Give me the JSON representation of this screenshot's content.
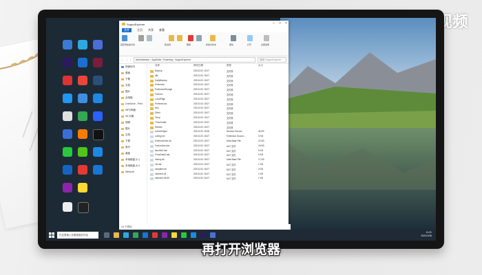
{
  "watermark": "天奇·视频",
  "subtitle": "再打开浏览器",
  "explorer": {
    "title": "SogouExplorer",
    "tabs": [
      "文件",
      "主页",
      "共享",
      "查看"
    ],
    "active_tab": "主页",
    "ribbon": [
      "固定到快速访问",
      "复制",
      "粘贴",
      "移动到",
      "复制到",
      "删除",
      "重命名",
      "新建文件夹",
      "属性",
      "打开",
      "全部选择"
    ],
    "address": [
      "Administrator",
      "AppData",
      "Roaming",
      "SogouExplorer"
    ],
    "search_placeholder": "搜索\"SogouExplorer\"",
    "columns": [
      "名称",
      "修改日期",
      "类型",
      "大小"
    ],
    "files": [
      {
        "name": "Backup",
        "date": "2021/1/21 15:07",
        "type": "文件夹",
        "size": ""
      },
      {
        "name": "dlls",
        "date": "2021/1/21 15:07",
        "type": "文件夹",
        "size": ""
      },
      {
        "name": "DailyBackup",
        "date": "2021/1/21 15:07",
        "type": "文件夹",
        "size": ""
      },
      {
        "name": "Extension",
        "date": "2021/1/21 15:07",
        "type": "文件夹",
        "size": ""
      },
      {
        "name": "ExtensionStorage",
        "date": "2021/1/21 15:07",
        "type": "文件夹",
        "size": ""
      },
      {
        "name": "FavIcon",
        "date": "2021/1/21 15:07",
        "type": "文件夹",
        "size": ""
      },
      {
        "name": "LocalPage",
        "date": "2021/1/21 15:07",
        "type": "文件夹",
        "size": ""
      },
      {
        "name": "Preferences",
        "date": "2021/1/21 15:07",
        "type": "文件夹",
        "size": ""
      },
      {
        "name": "skin",
        "date": "2021/1/21 15:07",
        "type": "文件夹",
        "size": ""
      },
      {
        "name": "Skins",
        "date": "2021/1/21 15:07",
        "type": "文件夹",
        "size": ""
      },
      {
        "name": "Temp",
        "date": "2021/1/21 15:07",
        "type": "文件夹",
        "size": ""
      },
      {
        "name": "Thumbnails",
        "date": "2021/1/21 15:07",
        "type": "文件夹",
        "size": ""
      },
      {
        "name": "WebAd",
        "date": "2021/1/21 15:07",
        "type": "文件夹",
        "size": ""
      },
      {
        "name": "cometoSgurl",
        "date": "2021/1/21 15:08",
        "type": "Neutron Docum...",
        "size": "46 KB"
      },
      {
        "name": "config.xml",
        "date": "2021/1/21 15:07",
        "type": "Extension Docum...",
        "size": "3 KB"
      },
      {
        "name": "ExtensionInfo.db",
        "date": "2021/1/21 15:07",
        "type": "Data Base File",
        "size": "22 KB"
      },
      {
        "name": "FavIconIdx.dat",
        "date": "2021/1/21 15:07",
        "type": "DAT 文件",
        "size": "16 KB"
      },
      {
        "name": "favorite3.dat",
        "date": "2021/1/21 15:07",
        "type": "DAT 文件",
        "size": "5 KB"
      },
      {
        "name": "FormData3.dat",
        "date": "2021/1/21 15:07",
        "type": "DAT 文件",
        "size": "5 KB"
      },
      {
        "name": "history.db",
        "date": "2021/1/21 15:07",
        "type": "Data Base File",
        "size": "17 KB"
      },
      {
        "name": "idx.dat",
        "date": "2021/1/21 15:07",
        "type": "DAT 文件",
        "size": "1 KB"
      },
      {
        "name": "sespfilter.dll",
        "date": "2021/1/21 15:07",
        "type": "DAT 文件",
        "size": "3 KB"
      },
      {
        "name": "uifavtm3.dll",
        "date": "2021/1/21 15:07",
        "type": "DAT 文件",
        "size": "1 KB"
      },
      {
        "name": "uifavtm3.dll.tlS",
        "date": "2021/1/21 15:07",
        "type": "DAT 文件",
        "size": "1 KB"
      }
    ],
    "nav": [
      "快速访问",
      "桌面",
      "下载",
      "文档",
      "图片",
      "此电脑",
      "OneDrive - Pers",
      "WPS网盘",
      "3D 对象",
      "视频",
      "图片",
      "文档",
      "下载",
      "音乐",
      "桌面",
      "本地磁盘 (C:)",
      "本地磁盘 (D:)",
      "Network"
    ],
    "status": "24 个项目"
  },
  "taskbar": {
    "search_placeholder": "在这里输入你要搜索的内容",
    "time": "11:21",
    "date": "2021/1/26"
  },
  "colors": {
    "accent": "#1a6fc9",
    "folder": "#e8b94a",
    "taskbar": "#1f2a36"
  }
}
